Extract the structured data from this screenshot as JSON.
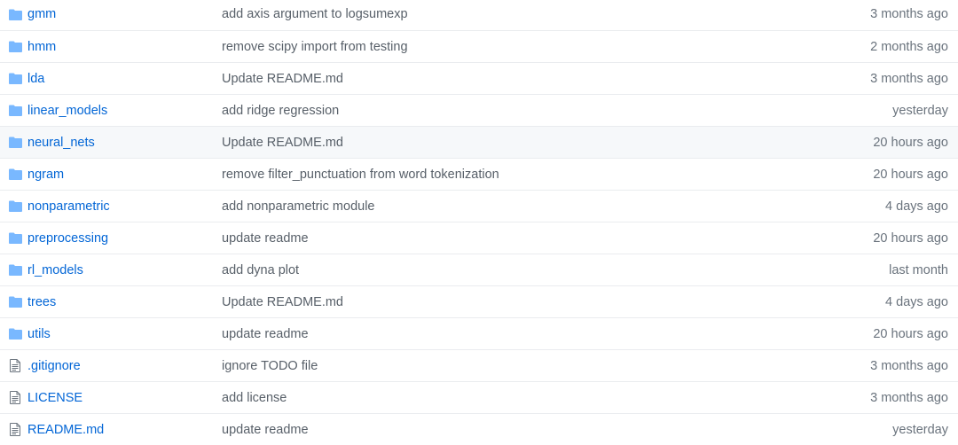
{
  "colors": {
    "folder_icon": "#79b8ff",
    "file_icon": "#6a737d",
    "link": "#0366d6",
    "message": "#586069",
    "age": "#6a737d",
    "row_highlight": "#f6f8fa"
  },
  "rows": [
    {
      "type": "folder",
      "icon": "folder-icon",
      "name": "gmm",
      "message": "add axis argument to logsumexp",
      "age": "3 months ago"
    },
    {
      "type": "folder",
      "icon": "folder-icon",
      "name": "hmm",
      "message": "remove scipy import from testing",
      "age": "2 months ago"
    },
    {
      "type": "folder",
      "icon": "folder-icon",
      "name": "lda",
      "message": "Update README.md",
      "age": "3 months ago"
    },
    {
      "type": "folder",
      "icon": "folder-icon",
      "name": "linear_models",
      "message": "add ridge regression",
      "age": "yesterday"
    },
    {
      "type": "folder",
      "icon": "folder-icon",
      "name": "neural_nets",
      "message": "Update README.md",
      "age": "20 hours ago",
      "highlighted": true
    },
    {
      "type": "folder",
      "icon": "folder-icon",
      "name": "ngram",
      "message": "remove filter_punctuation from word tokenization",
      "age": "20 hours ago"
    },
    {
      "type": "folder",
      "icon": "folder-icon",
      "name": "nonparametric",
      "message": "add nonparametric module",
      "age": "4 days ago"
    },
    {
      "type": "folder",
      "icon": "folder-icon",
      "name": "preprocessing",
      "message": "update readme",
      "age": "20 hours ago"
    },
    {
      "type": "folder",
      "icon": "folder-icon",
      "name": "rl_models",
      "message": "add dyna plot",
      "age": "last month"
    },
    {
      "type": "folder",
      "icon": "folder-icon",
      "name": "trees",
      "message": "Update README.md",
      "age": "4 days ago"
    },
    {
      "type": "folder",
      "icon": "folder-icon",
      "name": "utils",
      "message": "update readme",
      "age": "20 hours ago"
    },
    {
      "type": "file",
      "icon": "file-icon",
      "name": ".gitignore",
      "message": "ignore TODO file",
      "age": "3 months ago"
    },
    {
      "type": "file",
      "icon": "file-icon",
      "name": "LICENSE",
      "message": "add license",
      "age": "3 months ago"
    },
    {
      "type": "file",
      "icon": "file-icon",
      "name": "README.md",
      "message": "update readme",
      "age": "yesterday"
    }
  ]
}
